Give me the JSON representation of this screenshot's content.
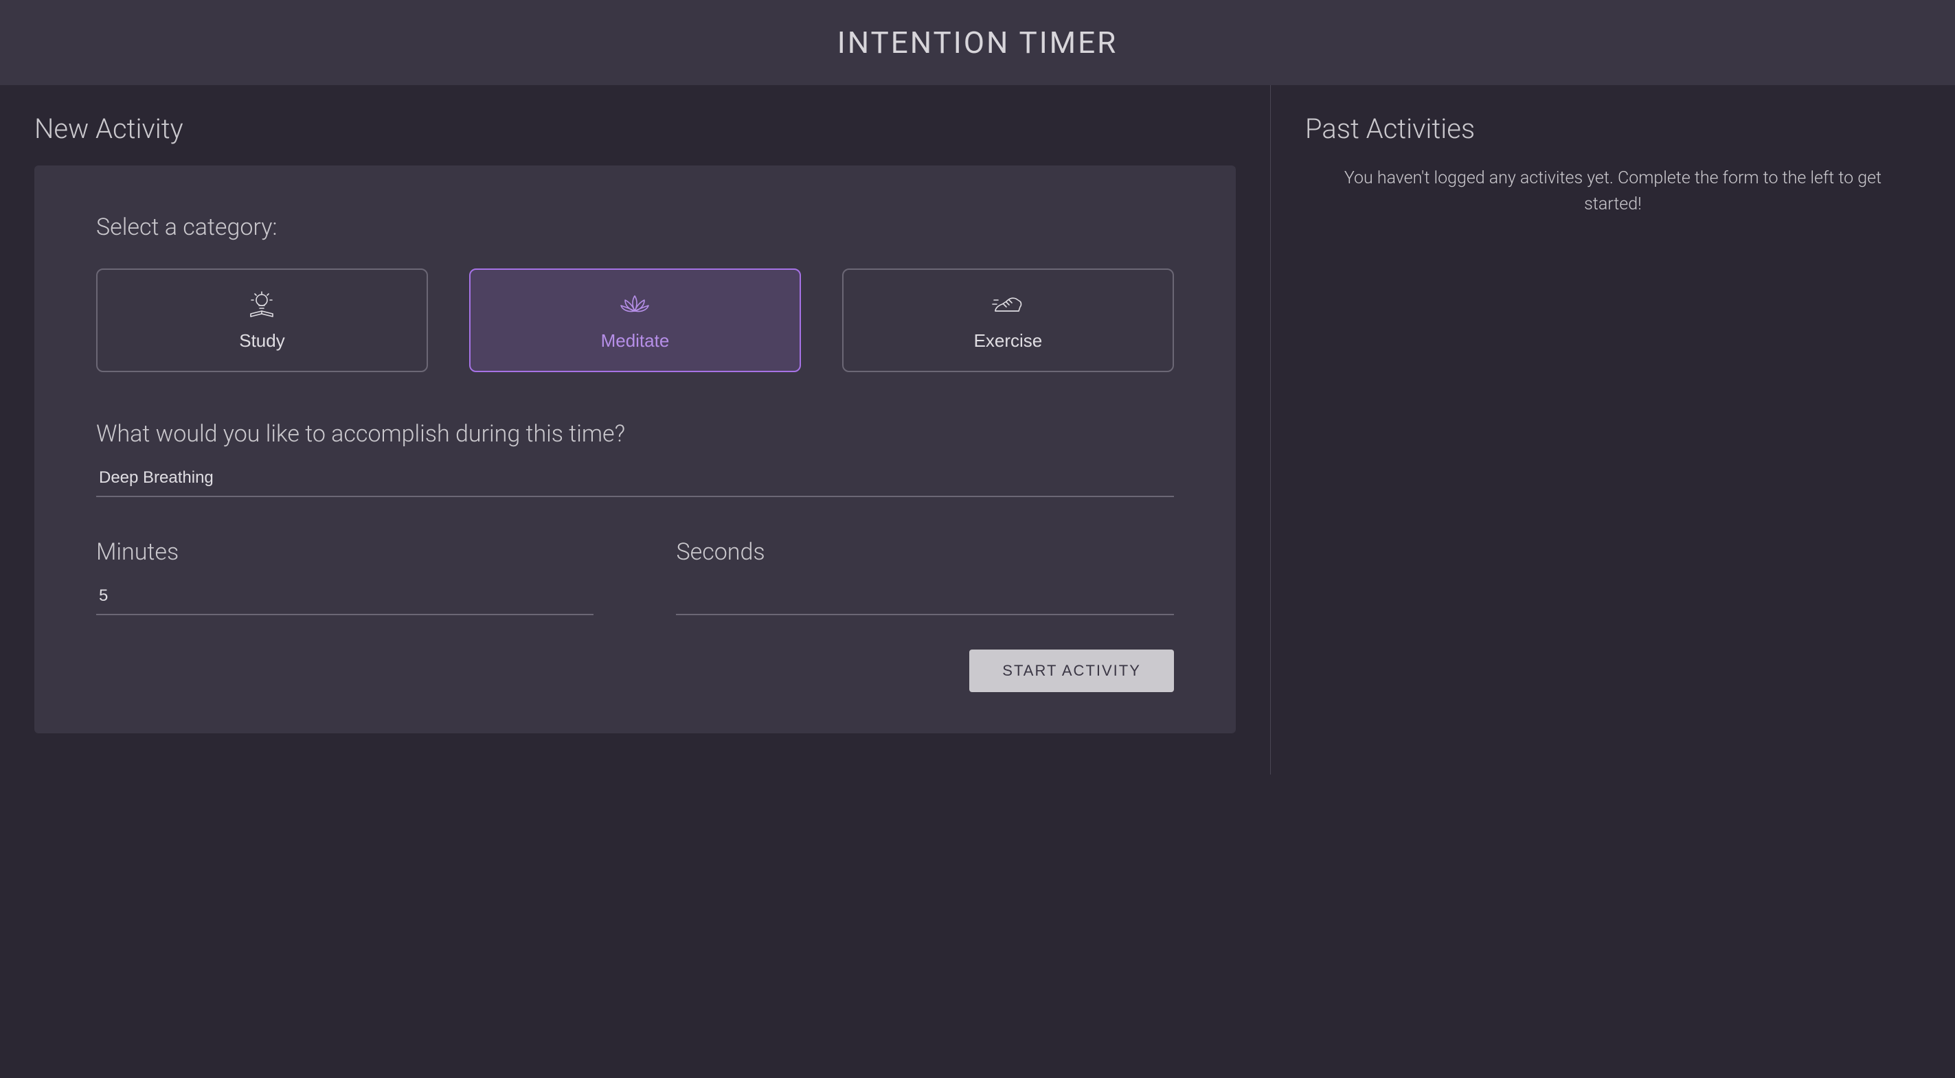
{
  "header": {
    "title": "INTENTION TIMER"
  },
  "newActivity": {
    "title": "New Activity",
    "selectCategoryLabel": "Select a category:",
    "categories": [
      {
        "label": "Study",
        "icon": "lightbulb-book-icon",
        "active": false
      },
      {
        "label": "Meditate",
        "icon": "lotus-icon",
        "active": true
      },
      {
        "label": "Exercise",
        "icon": "running-shoe-icon",
        "active": false
      }
    ],
    "accomplishLabel": "What would you like to accomplish during this time?",
    "accomplishValue": "Deep Breathing",
    "minutesLabel": "Minutes",
    "minutesValue": "5",
    "secondsLabel": "Seconds",
    "secondsValue": "",
    "startButton": "START ACTIVITY"
  },
  "pastActivities": {
    "title": "Past Activities",
    "emptyMessage": "You haven't logged any activites yet. Complete the form to the left to get started!"
  },
  "colors": {
    "accentPurple": "#A673E6",
    "panel": "#3A3644",
    "background": "#2B2733"
  }
}
